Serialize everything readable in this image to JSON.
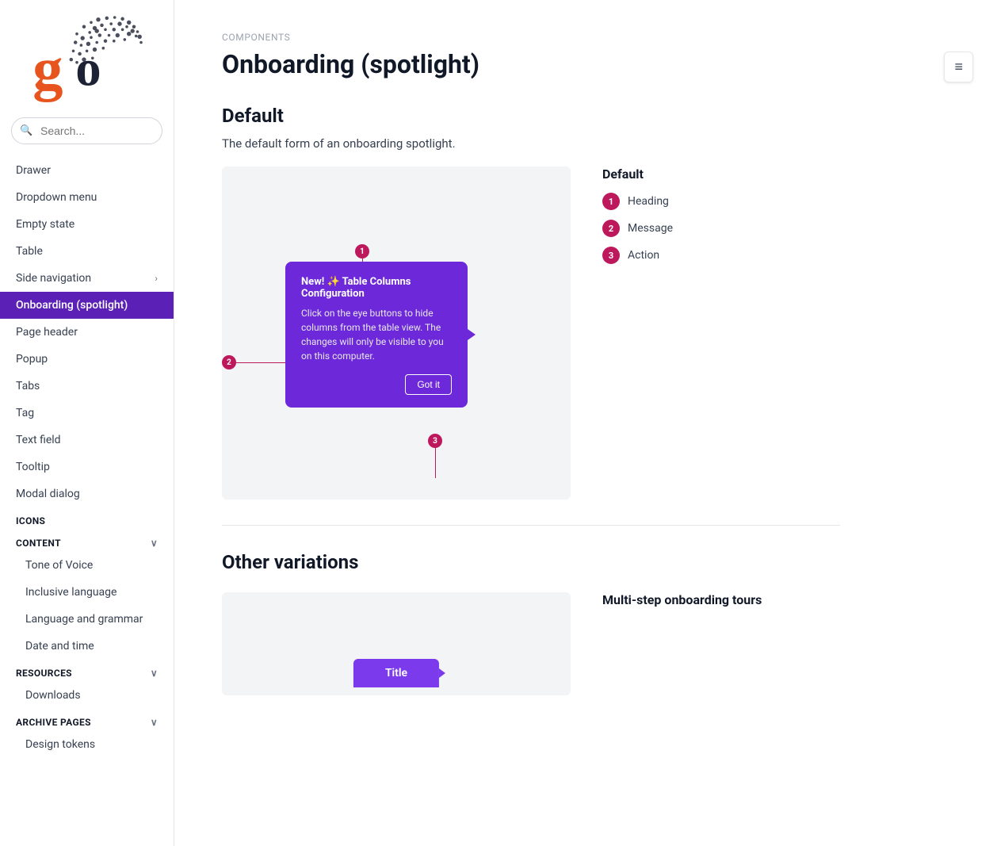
{
  "sidebar": {
    "nav_items": [
      {
        "label": "Drawer",
        "active": false,
        "has_arrow": false
      },
      {
        "label": "Dropdown menu",
        "active": false,
        "has_arrow": false
      },
      {
        "label": "Empty state",
        "active": false,
        "has_arrow": false
      },
      {
        "label": "Table",
        "active": false,
        "has_arrow": false
      },
      {
        "label": "Side navigation",
        "active": false,
        "has_arrow": true
      },
      {
        "label": "Onboarding (spotlight)",
        "active": true,
        "has_arrow": false
      },
      {
        "label": "Page header",
        "active": false,
        "has_arrow": false
      },
      {
        "label": "Popup",
        "active": false,
        "has_arrow": false
      },
      {
        "label": "Tabs",
        "active": false,
        "has_arrow": false
      },
      {
        "label": "Tag",
        "active": false,
        "has_arrow": false
      },
      {
        "label": "Text field",
        "active": false,
        "has_arrow": false
      },
      {
        "label": "Tooltip",
        "active": false,
        "has_arrow": false
      },
      {
        "label": "Modal dialog",
        "active": false,
        "has_arrow": false
      }
    ],
    "sections": [
      {
        "label": "ICONS",
        "collapsible": false,
        "items": []
      },
      {
        "label": "CONTENT",
        "collapsible": true,
        "items": [
          {
            "label": "Tone of Voice"
          },
          {
            "label": "Inclusive language"
          },
          {
            "label": "Language and grammar"
          },
          {
            "label": "Date and time"
          }
        ]
      },
      {
        "label": "RESOURCES",
        "collapsible": true,
        "items": [
          {
            "label": "Downloads"
          }
        ]
      },
      {
        "label": "ARCHIVE PAGES",
        "collapsible": true,
        "items": [
          {
            "label": "Design tokens"
          }
        ]
      }
    ],
    "search_placeholder": "Search..."
  },
  "page": {
    "breadcrumb": "COMPONENTS",
    "title": "Onboarding (spotlight)",
    "default_section": {
      "heading": "Default",
      "description": "The default form of an onboarding spotlight."
    },
    "legend": {
      "title": "Default",
      "items": [
        {
          "number": "1",
          "label": "Heading"
        },
        {
          "number": "2",
          "label": "Message"
        },
        {
          "number": "3",
          "label": "Action"
        }
      ]
    },
    "spotlight": {
      "title": "New! ✨ Table Columns Configuration",
      "body": "Click on the eye buttons to hide columns from the table view. The changes will only be visible to you on this computer.",
      "button": "Got it"
    },
    "other_variations": {
      "heading": "Other variations",
      "variation_title": "Title",
      "variation_label": "Multi-step onboarding tours"
    }
  },
  "toc_button": {
    "icon": "≡"
  }
}
